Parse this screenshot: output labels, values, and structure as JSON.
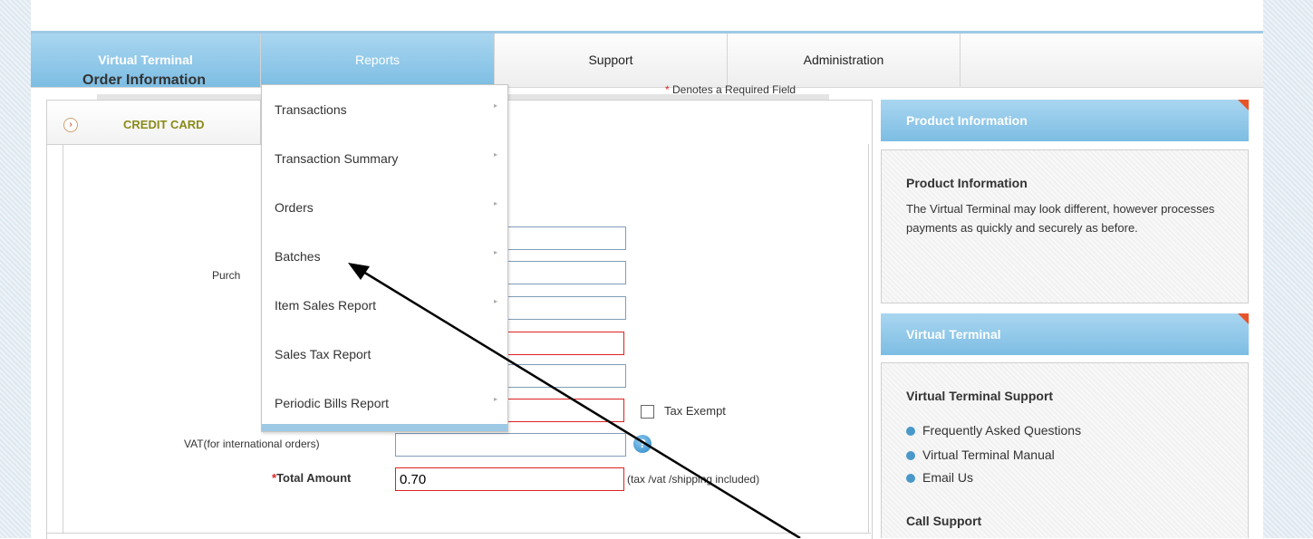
{
  "nav": {
    "tabs": [
      {
        "label": "Virtual Terminal"
      },
      {
        "label": "Reports"
      },
      {
        "label": "Support"
      },
      {
        "label": "Administration"
      }
    ]
  },
  "reports_menu": {
    "items": [
      {
        "label": "Transactions",
        "submenu": true
      },
      {
        "label": "Transaction Summary",
        "submenu": true
      },
      {
        "label": "Orders",
        "submenu": true
      },
      {
        "label": "Batches",
        "submenu": true
      },
      {
        "label": "Item Sales Report",
        "submenu": true
      },
      {
        "label": "Sales Tax Report",
        "submenu": false
      },
      {
        "label": "Periodic Bills Report",
        "submenu": true
      }
    ],
    "arrow_glyph": "▸"
  },
  "payment_tab": {
    "label": "CREDIT CARD",
    "arrow_glyph": "›"
  },
  "order_form": {
    "title": "Order Information",
    "required_star": "*",
    "required_note": "Denotes a Required Field",
    "purchase_label_partial": "Purch",
    "tax_exempt_label": "Tax Exempt",
    "vat_label": "VAT(for international orders)",
    "total_label": "Total Amount",
    "total_value": "0.70",
    "total_note": "(tax /vat /shipping included)",
    "help_glyph": "?"
  },
  "product_info": {
    "header": "Product Information",
    "title": "Product Information",
    "text": "The Virtual Terminal may look different, however processes payments as quickly and securely as before."
  },
  "virtual_terminal": {
    "header": "Virtual Terminal",
    "support_title": "Virtual Terminal Support",
    "links": [
      {
        "label": "Frequently Asked Questions"
      },
      {
        "label": "Virtual Terminal Manual"
      },
      {
        "label": "Email Us"
      }
    ],
    "call_support": "Call Support"
  },
  "colors": {
    "nav_blue": "#7dbde3",
    "required_red": "#dd2222",
    "accent_orange": "#e8542a"
  }
}
